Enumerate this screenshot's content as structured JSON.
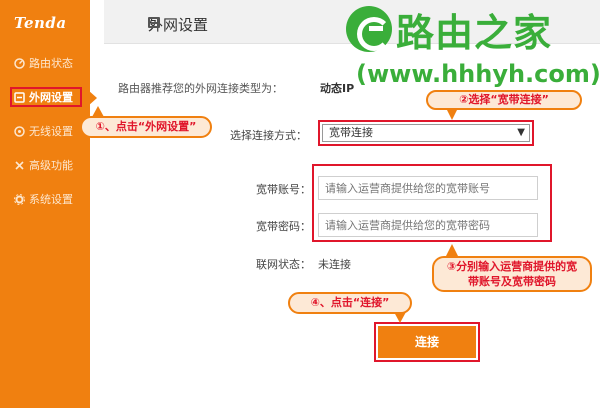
{
  "sidebar": {
    "logo": "Tenda",
    "items": [
      {
        "label": "路由状态",
        "icon": "gauge-icon"
      },
      {
        "label": "外网设置",
        "icon": "globe-icon",
        "active": true
      },
      {
        "label": "无线设置",
        "icon": "wifi-icon"
      },
      {
        "label": "高级功能",
        "icon": "tools-icon"
      },
      {
        "label": "系统设置",
        "icon": "gear-icon"
      }
    ]
  },
  "header": {
    "title": "外网设置",
    "icon": "network-icon"
  },
  "watermark": {
    "name": "路由之家",
    "url": "(www.hhhyh.com)"
  },
  "content": {
    "recommend_label": "路由器推荐您的外网连接类型为：",
    "recommend_value": "动态IP",
    "connection_label": "选择连接方式：",
    "connection_value": "宽带连接",
    "account_label": "宽带账号：",
    "account_placeholder": "请输入运营商提供给您的宽带账号",
    "password_label": "宽带密码：",
    "password_placeholder": "请输入运营商提供给您的宽带密码",
    "status_label": "联网状态：",
    "status_value": "未连接",
    "connect_button": "连接"
  },
  "callouts": {
    "step1": "①、点击“外网设置”",
    "step2": "②选择“宽带连接”",
    "step3_line1": "③分别输入运营商提供的宽",
    "step3_line2": "带账号及宽带密码",
    "step4": "④、点击“连接”"
  },
  "colors": {
    "brand_orange": "#f08010",
    "highlight_red": "#e0162b",
    "watermark_green": "#3aae3a"
  }
}
